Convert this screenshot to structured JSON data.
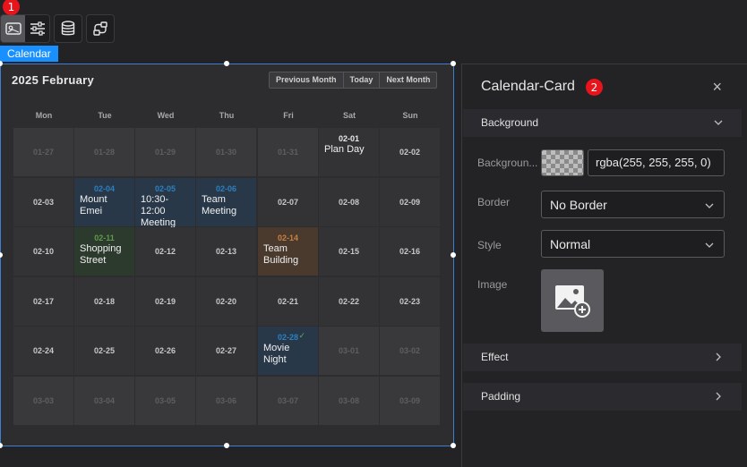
{
  "toolbar": {
    "badge1": "1",
    "icons": [
      "card-icon",
      "sliders-icon",
      "database-icon",
      "flow-icon"
    ]
  },
  "widget_label": "Calendar",
  "calendar": {
    "title": "2025 February",
    "nav": {
      "prev": "Previous Month",
      "today": "Today",
      "next": "Next Month"
    },
    "weekdays": [
      "Mon",
      "Tue",
      "Wed",
      "Thu",
      "Fri",
      "Sat",
      "Sun"
    ],
    "weeks": [
      [
        {
          "d": "01-27",
          "out": true
        },
        {
          "d": "01-28",
          "out": true
        },
        {
          "d": "01-29",
          "out": true
        },
        {
          "d": "01-30",
          "out": true
        },
        {
          "d": "01-31",
          "out": true
        },
        {
          "d": "02-01",
          "ev": "Plan Day",
          "color": "plain"
        },
        {
          "d": "02-02"
        }
      ],
      [
        {
          "d": "02-03"
        },
        {
          "d": "02-04",
          "ev": "Mount Emei",
          "color": "blue"
        },
        {
          "d": "02-05",
          "ev": "10:30-12:00 Meeting",
          "color": "blue"
        },
        {
          "d": "02-06",
          "ev": "Team Meeting",
          "color": "blue"
        },
        {
          "d": "02-07"
        },
        {
          "d": "02-08"
        },
        {
          "d": "02-09"
        }
      ],
      [
        {
          "d": "02-10"
        },
        {
          "d": "02-11",
          "ev": "Shopping Street",
          "color": "green"
        },
        {
          "d": "02-12"
        },
        {
          "d": "02-13"
        },
        {
          "d": "02-14",
          "ev": "Team Building",
          "color": "orange"
        },
        {
          "d": "02-15"
        },
        {
          "d": "02-16"
        }
      ],
      [
        {
          "d": "02-17"
        },
        {
          "d": "02-18"
        },
        {
          "d": "02-19"
        },
        {
          "d": "02-20"
        },
        {
          "d": "02-21"
        },
        {
          "d": "02-22"
        },
        {
          "d": "02-23"
        }
      ],
      [
        {
          "d": "02-24"
        },
        {
          "d": "02-25"
        },
        {
          "d": "02-26"
        },
        {
          "d": "02-27"
        },
        {
          "d": "02-28",
          "ev": "Movie Night",
          "color": "blue",
          "check": true
        },
        {
          "d": "03-01",
          "out": true
        },
        {
          "d": "03-02",
          "out": true
        }
      ],
      [
        {
          "d": "03-03",
          "out": true
        },
        {
          "d": "03-04",
          "out": true
        },
        {
          "d": "03-05",
          "out": true
        },
        {
          "d": "03-06",
          "out": true
        },
        {
          "d": "03-07",
          "out": true
        },
        {
          "d": "03-08",
          "out": true
        },
        {
          "d": "03-09",
          "out": true
        }
      ]
    ]
  },
  "panel": {
    "title": "Calendar-Card",
    "badge2": "2",
    "close": "×",
    "sections": {
      "background": "Background",
      "effect": "Effect",
      "padding": "Padding"
    },
    "fields": {
      "background_label": "Backgroun...",
      "background_value": "rgba(255, 255, 255, 0)",
      "border_label": "Border",
      "border_value": "No Border",
      "style_label": "Style",
      "style_value": "Normal",
      "image_label": "Image"
    }
  },
  "colors": {
    "accent": "#1890ff",
    "badge": "#e8141c",
    "selection": "#3d7fd4"
  }
}
